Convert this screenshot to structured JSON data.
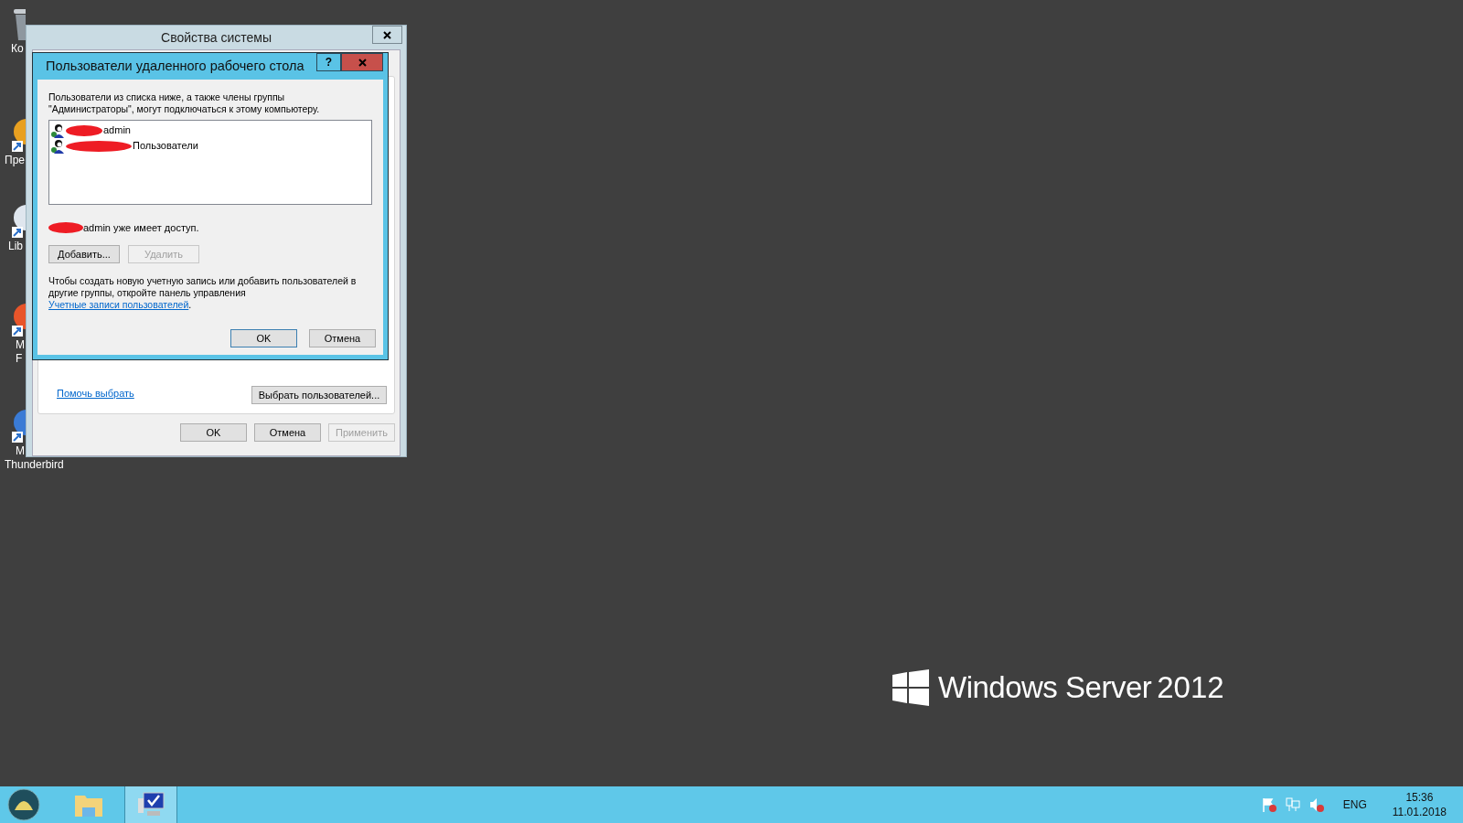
{
  "desktop_icons": [
    {
      "kind": "bin",
      "lines": [
        "Ко"
      ]
    },
    {
      "kind": "app",
      "lines": [
        "Пре"
      ]
    },
    {
      "kind": "doc",
      "lines": [
        "Lib"
      ]
    },
    {
      "kind": "fox",
      "lines": [
        "M",
        "F"
      ]
    },
    {
      "kind": "bird",
      "lines": [
        "M",
        "Thunderbird"
      ]
    }
  ],
  "system_properties": {
    "title": "Свойства системы",
    "help_link": "Помочь выбрать",
    "select_button": "Выбрать пользователей...",
    "buttons": [
      {
        "label": "OK",
        "disabled": false
      },
      {
        "label": "Отмена",
        "disabled": false
      },
      {
        "label": "Применить",
        "disabled": true
      }
    ]
  },
  "rdp_dialog": {
    "title": "Пользователи удаленного рабочего стола",
    "help": "?",
    "intro": "Пользователи из списка ниже, а также члены группы \"Администраторы\", могут подключаться к этому компьютеру.",
    "users": [
      {
        "name": "admin"
      },
      {
        "name": "Пользователи"
      }
    ],
    "status": "admin уже имеет доступ.",
    "actions": [
      {
        "label": "Добавить...",
        "disabled": false
      },
      {
        "label": "Удалить",
        "disabled": true
      }
    ],
    "note": "Чтобы создать новую учетную запись или добавить пользователей в другие группы, откройте панель управления",
    "note_link": "Учетные записи пользователей",
    "note_end": ".",
    "buttons": [
      {
        "label": "OK",
        "default": true
      },
      {
        "label": "Отмена",
        "default": false
      }
    ]
  },
  "logo": {
    "brand": "Windows Server",
    "version": "2012"
  },
  "taskbar": {
    "apps": [
      {
        "kind": "explorer",
        "selected": false
      },
      {
        "kind": "rdp",
        "selected": true
      }
    ],
    "language": "ENG",
    "time": "15:36",
    "date": "11.01.2018"
  }
}
